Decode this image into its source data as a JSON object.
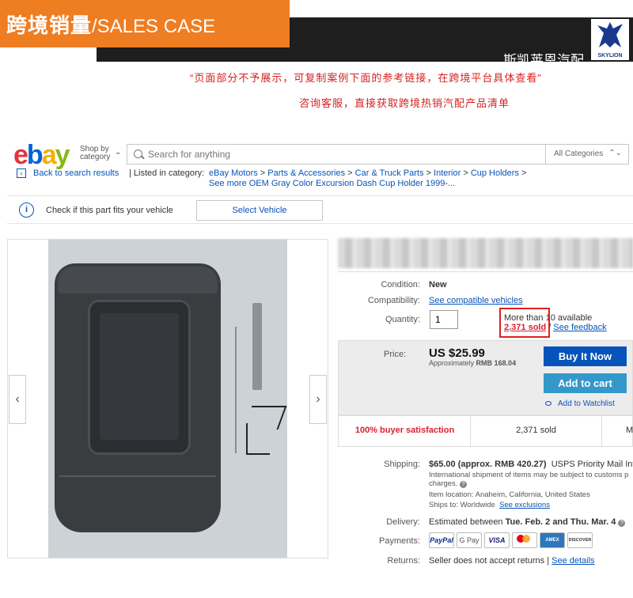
{
  "header": {
    "title_cn": "跨境销量",
    "title_en": "/SALES CASE",
    "brand": "斯凯莱恩汽配",
    "logo_text": "SKYLION",
    "notice_line1": "“页面部分不予展示，可复制案例下面的参考链接，在跨境平台具体查看”",
    "notice_line2": "咨询客服，直接获取跨境热销汽配产品清单"
  },
  "ebay": {
    "logo": {
      "e": "e",
      "b": "b",
      "a": "a",
      "y": "y"
    },
    "shop_by": "Shop by",
    "shop_by_2": "category",
    "search_placeholder": "Search for anything",
    "category_select": "All Categories",
    "back_link": "Back to search results",
    "listed_in": "| Listed in category:",
    "breadcrumb": [
      "eBay Motors",
      "Parts & Accessories",
      "Car & Truck Parts",
      "Interior",
      "Cup Holders"
    ],
    "see_more": "See more OEM Gray Color Excursion Dash Cup Holder 1999-...",
    "fits_text": "Check if this part fits your vehicle",
    "select_vehicle": "Select Vehicle",
    "nav_prev": "‹",
    "nav_next": "›"
  },
  "listing": {
    "condition_label": "Condition:",
    "condition": "New",
    "compat_label": "Compatibility:",
    "compat_link": "See compatible vehicles",
    "quantity_label": "Quantity:",
    "quantity": "1",
    "availability": "More than 10 available",
    "sold": "2,371 sold",
    "feedback": "See feedback",
    "price_label": "Price:",
    "price": "US $25.99",
    "approx_prefix": "Approximately",
    "approx_value": "RMB 168.04",
    "buy_now": "Buy It Now",
    "add_cart": "Add to cart",
    "watchlist": "Add to Watchlist",
    "satisfaction": "100% buyer satisfaction",
    "sold_stat": "2,371 sold",
    "more_stat": "M",
    "shipping_label": "Shipping:",
    "shipping_cost": "$65.00 (approx. RMB 420.27)",
    "shipping_method": "USPS Priority Mail Inte",
    "intl_note_1": "International shipment of items may be subject to customs p",
    "intl_note_2": "charges.",
    "item_location": "Item location:  Anaheim, California, United States",
    "ships_to": "Ships to:  Worldwide",
    "see_exclusions": "See exclusions",
    "delivery_label": "Delivery:",
    "delivery": "Estimated between",
    "delivery_dates": "Tue. Feb. 2 and Thu. Mar. 4",
    "payments_label": "Payments:",
    "payment_methods": [
      "PayPal",
      "G Pay",
      "VISA",
      "",
      "AMEX",
      "DISCOVER"
    ],
    "returns_label": "Returns:",
    "returns": "Seller does not accept returns |",
    "see_details": "See details"
  },
  "colors": {
    "accent_orange": "#ef7d22",
    "ebay_blue": "#0654ba",
    "sold_red": "#dd1e31"
  }
}
